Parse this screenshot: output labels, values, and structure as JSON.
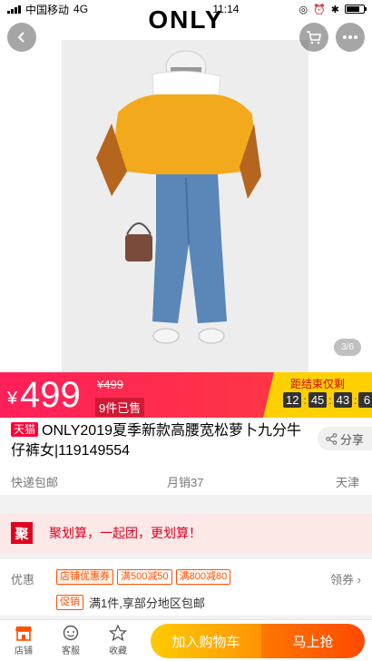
{
  "status_bar": {
    "carrier": "中国移动",
    "network": "4G",
    "time": "11:14"
  },
  "header": {
    "brand": "ONLY",
    "back_icon": "back-arrow-icon",
    "cart_icon": "cart-icon",
    "more_icon": "more-dots-icon"
  },
  "gallery": {
    "indicator": "3/6"
  },
  "price": {
    "symbol": "¥",
    "current": "499",
    "original": "¥499",
    "sold": "9件已售"
  },
  "countdown": {
    "title": "距结束仅剩",
    "hours": "12",
    "minutes": "45",
    "seconds": "43",
    "tenths": "6"
  },
  "product": {
    "tag": "天猫",
    "title": "ONLY2019夏季新款高腰宽松萝卜九分牛仔裤女|119149554",
    "share": "分享"
  },
  "meta": {
    "shipping": "快递包邮",
    "monthly_sales": "月销37",
    "location": "天津"
  },
  "juhuasuan": {
    "icon_text": "聚",
    "text": "聚划算，一起团，更划算！"
  },
  "promo": {
    "label": "优惠",
    "store_coupon": "店铺优惠券",
    "coupon1": "满500减50",
    "coupon2": "满800减80",
    "coupon_link": "领券",
    "promo_tag": "促销",
    "promo_desc": "满1件,享部分地区包邮"
  },
  "bottom_bar": {
    "store": "店铺",
    "service": "客服",
    "favorite": "收藏",
    "add_cart": "加入购物车",
    "buy_now": "马上抢"
  },
  "colors": {
    "tmall_red": "#ff0036",
    "price_bar": "#ff1f5a",
    "countdown_bg": "#ffd000",
    "cart_button": "#ffb000",
    "buy_button": "#ff5500"
  }
}
